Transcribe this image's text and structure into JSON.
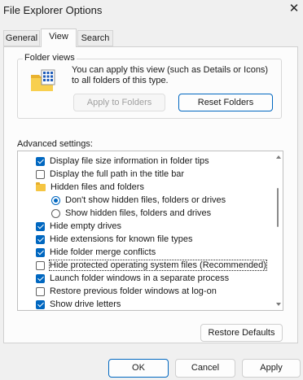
{
  "window": {
    "title": "File Explorer Options",
    "close_glyph": "✕"
  },
  "tabs": [
    {
      "label": "General",
      "active": false
    },
    {
      "label": "View",
      "active": true
    },
    {
      "label": "Search",
      "active": false
    }
  ],
  "folder_views": {
    "group_label": "Folder views",
    "description": "You can apply this view (such as Details or Icons) to all folders of this type.",
    "apply_button": "Apply to Folders",
    "reset_button": "Reset Folders"
  },
  "advanced": {
    "label": "Advanced settings:",
    "items": [
      {
        "kind": "checkbox",
        "label": "Display file size information in folder tips",
        "checked": true,
        "indent": 0
      },
      {
        "kind": "checkbox",
        "label": "Display the full path in the title bar",
        "checked": false,
        "indent": 0
      },
      {
        "kind": "folder",
        "label": "Hidden files and folders",
        "indent": 0
      },
      {
        "kind": "radio",
        "label": "Don't show hidden files, folders or drives",
        "checked": true,
        "indent": 1
      },
      {
        "kind": "radio",
        "label": "Show hidden files, folders and drives",
        "checked": false,
        "indent": 1
      },
      {
        "kind": "checkbox",
        "label": "Hide empty drives",
        "checked": true,
        "indent": 0
      },
      {
        "kind": "checkbox",
        "label": "Hide extensions for known file types",
        "checked": true,
        "indent": 0
      },
      {
        "kind": "checkbox",
        "label": "Hide folder merge conflicts",
        "checked": true,
        "indent": 0
      },
      {
        "kind": "checkbox",
        "label": "Hide protected operating system files (Recommended)",
        "checked": false,
        "indent": 0,
        "focused": true
      },
      {
        "kind": "checkbox",
        "label": "Launch folder windows in a separate process",
        "checked": true,
        "indent": 0
      },
      {
        "kind": "checkbox",
        "label": "Restore previous folder windows at log-on",
        "checked": false,
        "indent": 0
      },
      {
        "kind": "checkbox",
        "label": "Show drive letters",
        "checked": true,
        "indent": 0
      }
    ],
    "restore_defaults": "Restore Defaults"
  },
  "footer": {
    "ok": "OK",
    "cancel": "Cancel",
    "apply": "Apply"
  },
  "colors": {
    "accent": "#0067c0",
    "folder": "#f5c542"
  }
}
